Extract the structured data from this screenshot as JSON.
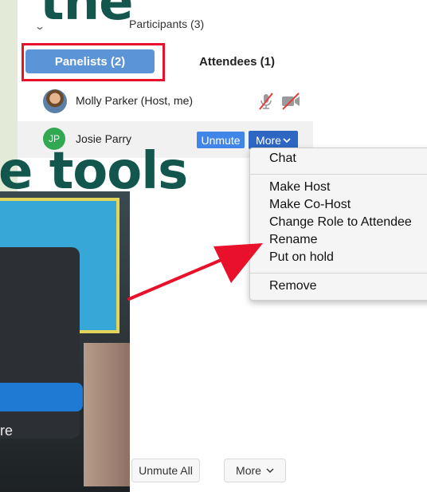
{
  "article_overlay": {
    "heading_fragment_top": "the",
    "heading_fragment_tools": "e tools",
    "photo_caption_fragment": "re"
  },
  "participants_panel": {
    "title": "Participants (3)",
    "tabs": [
      {
        "label": "Panelists (2)",
        "active": true
      },
      {
        "label": "Attendees (1)",
        "active": false
      }
    ],
    "participants": [
      {
        "name": "Molly Parker (Host, me)",
        "avatar": "photo"
      },
      {
        "name": "Josie Parry",
        "initials": "JP",
        "avatar_color": "#32a852"
      }
    ],
    "row_actions": {
      "unmute_label": "Unmute",
      "more_label": "More"
    },
    "footer": {
      "unmute_all_label": "Unmute All",
      "more_label": "More"
    }
  },
  "context_menu": {
    "items": [
      "Chat",
      "Make Host",
      "Make Co-Host",
      "Change Role to Attendee",
      "Rename",
      "Put on hold",
      "Remove"
    ]
  },
  "colors": {
    "highlight_red": "#e8102a",
    "tab_blue": "#5b95d8",
    "unmute_blue": "#3f86e8",
    "more_blue": "#2d67c3",
    "heading_green": "#12564d",
    "background_green": "#dfe9d6"
  },
  "icons": [
    "chevron-down-icon",
    "muted-mic-icon",
    "video-off-icon",
    "chevron-down-icon"
  ]
}
